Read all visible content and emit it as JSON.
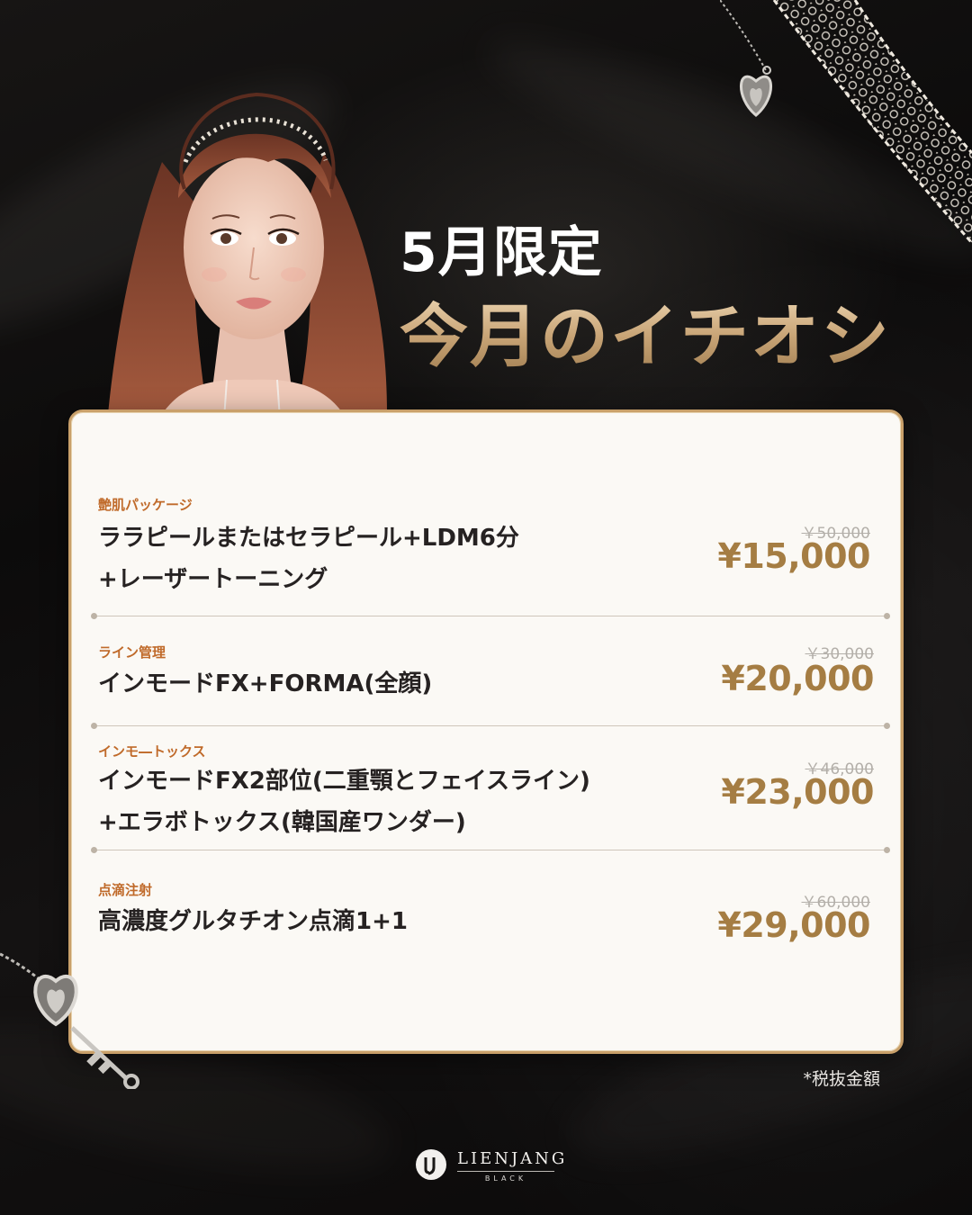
{
  "headline": {
    "sub": "5月限定",
    "main": "今月のイチオシ"
  },
  "menu": [
    {
      "category": "艶肌パッケージ",
      "lines": [
        "ララピールまたはセラピール+LDM6分",
        "+レーザートーニング"
      ],
      "original_price": "￥50,000",
      "price": "¥15,000"
    },
    {
      "category": "ライン管理",
      "lines": [
        "インモードFX+FORMA(全顔)"
      ],
      "original_price": "￥30,000",
      "price": "¥20,000"
    },
    {
      "category": "インモ―トックス",
      "lines": [
        "インモードFX2部位(二重顎とフェイスライン)",
        "+エラボトックス(韓国産ワンダー)"
      ],
      "original_price": "￥46,000",
      "price": "¥23,000"
    },
    {
      "category": "点滴注射",
      "lines": [
        "高濃度グルタチオン点滴1+1"
      ],
      "original_price": "￥60,000",
      "price": "¥29,000"
    }
  ],
  "tax_note": "*税抜金額",
  "brand": {
    "name": "LIENJANG",
    "sub": "BLACK"
  },
  "colors": {
    "background": "#0b0a0a",
    "card": "#fbf9f5",
    "card_border": "#c9a06a",
    "category": "#c06a2a",
    "price": "#a57d43",
    "strike_price": "#b3afa9",
    "headline_gold": "#c9a577"
  },
  "icons": [
    "model-portrait",
    "lace-ribbon-heart-locket",
    "heart-key-charm",
    "lienjang-logo-icon"
  ]
}
